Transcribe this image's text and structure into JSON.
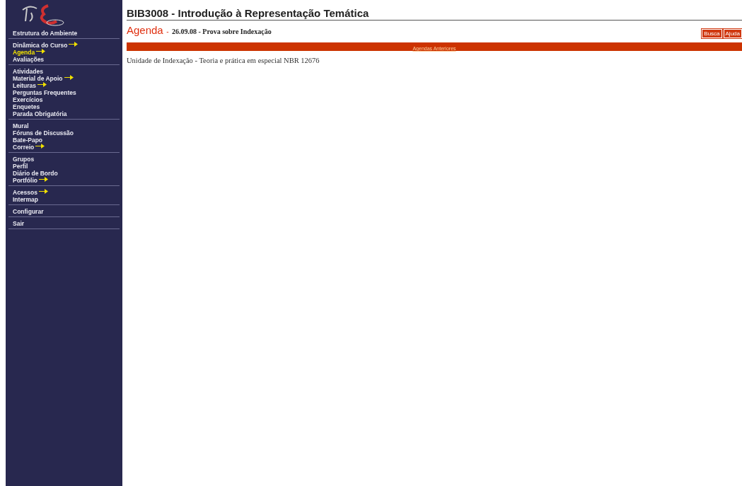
{
  "sidebar": {
    "groups": [
      {
        "items": [
          {
            "label": "Estrutura do Ambiente",
            "selected": false,
            "arrow": false
          }
        ]
      },
      {
        "items": [
          {
            "label": "Dinâmica do Curso",
            "selected": false,
            "arrow": true
          },
          {
            "label": "Agenda",
            "selected": true,
            "arrow": true
          },
          {
            "label": "Avaliações",
            "selected": false,
            "arrow": false
          }
        ]
      },
      {
        "items": [
          {
            "label": "Atividades",
            "selected": false,
            "arrow": false
          },
          {
            "label": "Material de Apoio",
            "selected": false,
            "arrow": true
          },
          {
            "label": "Leituras",
            "selected": false,
            "arrow": true
          },
          {
            "label": "Perguntas Frequentes",
            "selected": false,
            "arrow": false
          },
          {
            "label": "Exercícios",
            "selected": false,
            "arrow": false
          },
          {
            "label": "Enquetes",
            "selected": false,
            "arrow": false
          },
          {
            "label": "Parada Obrigatória",
            "selected": false,
            "arrow": false
          }
        ]
      },
      {
        "items": [
          {
            "label": "Mural",
            "selected": false,
            "arrow": false
          },
          {
            "label": "Fóruns de Discussão",
            "selected": false,
            "arrow": false
          },
          {
            "label": "Bate-Papo",
            "selected": false,
            "arrow": false
          },
          {
            "label": "Correio",
            "selected": false,
            "arrow": true
          }
        ]
      },
      {
        "items": [
          {
            "label": "Grupos",
            "selected": false,
            "arrow": false
          },
          {
            "label": "Perfil",
            "selected": false,
            "arrow": false
          },
          {
            "label": "Diário de Bordo",
            "selected": false,
            "arrow": false
          },
          {
            "label": "Portfólio",
            "selected": false,
            "arrow": true
          }
        ]
      },
      {
        "items": [
          {
            "label": "Acessos",
            "selected": false,
            "arrow": true
          },
          {
            "label": "Intermap",
            "selected": false,
            "arrow": false
          }
        ]
      },
      {
        "items": [
          {
            "label": "Configurar",
            "selected": false,
            "arrow": false
          }
        ]
      },
      {
        "items": [
          {
            "label": "Sair",
            "selected": false,
            "arrow": false
          }
        ]
      }
    ]
  },
  "course_title": "BIB3008 - Introdução à Representação Temática",
  "section": {
    "name": "Agenda",
    "separator": "-",
    "subtitle": "26.09.08 - Prova sobre Indexação"
  },
  "buttons": [
    "Busca",
    "Ajuda"
  ],
  "bar_link": "Agendas Anteriores",
  "body_text": "Unidade de Indexação - Teoria e prática em especial NBR 12676"
}
